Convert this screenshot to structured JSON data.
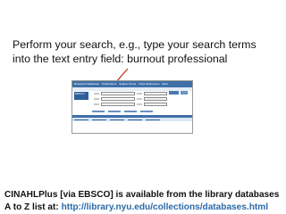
{
  "instruction": {
    "line1": "Perform your search, e.g., type your search terms",
    "line2": "into the text entry field:  burnout professional"
  },
  "screenshot": {
    "nav_items": [
      "Research Databases",
      "Publications",
      "Subject Terms",
      "Cited References",
      "More"
    ],
    "logo_text": "EBSCO"
  },
  "footer": {
    "line1": "CINAHLPlus [via EBSCO] is available from the library databases",
    "line2_prefix": "A to Z list at: ",
    "url": "http://library.nyu.edu/collections/databases.html"
  },
  "colors": {
    "accent": "#3f6fa8",
    "link": "#2c6aa8",
    "pointer": "#c0392b"
  }
}
